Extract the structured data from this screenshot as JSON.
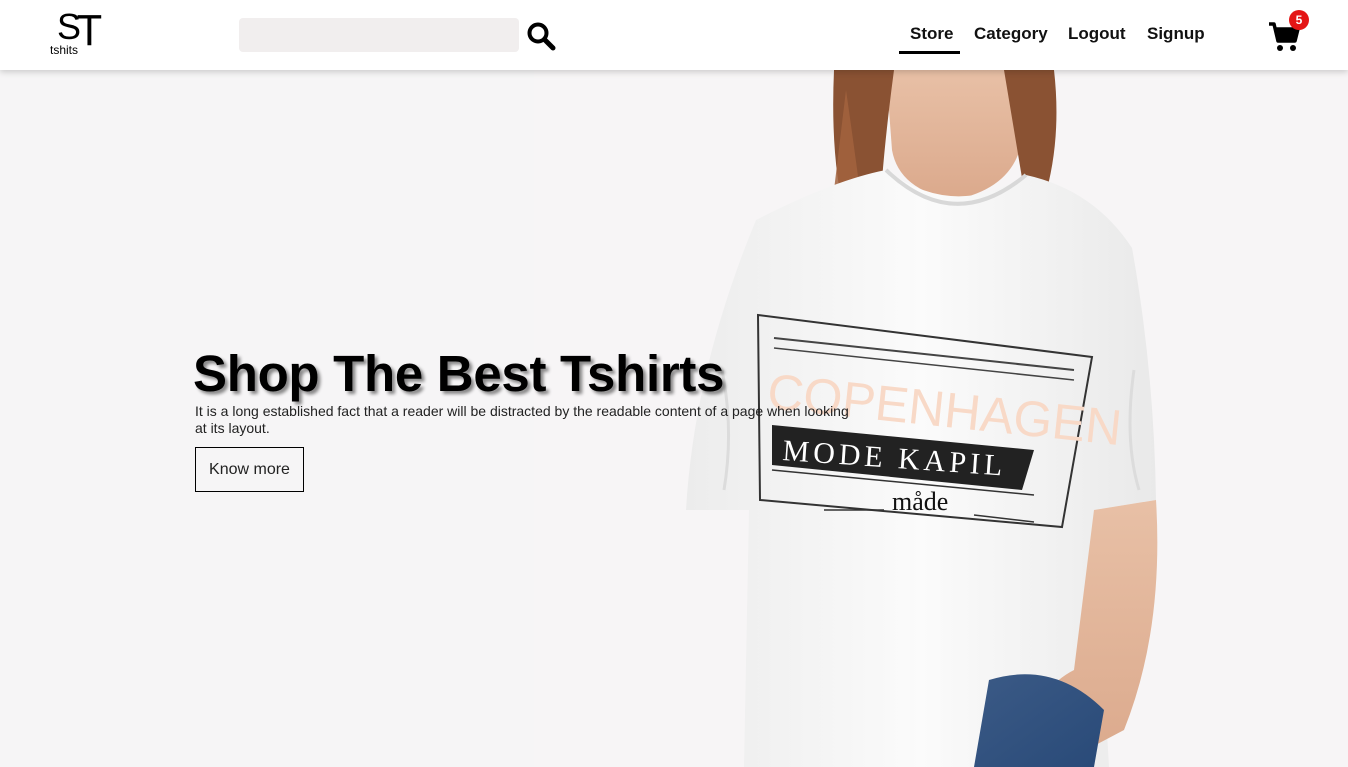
{
  "brand": {
    "logo_s": "S",
    "logo_t": "T",
    "logo_sub": "tshits"
  },
  "search": {
    "placeholder": "",
    "value": "",
    "icon": "search-icon"
  },
  "nav": {
    "items": [
      {
        "label": "Store",
        "active": true
      },
      {
        "label": "Category",
        "active": false
      },
      {
        "label": "Logout",
        "active": false
      },
      {
        "label": "Signup",
        "active": false
      }
    ]
  },
  "cart": {
    "icon": "shopping-cart-icon",
    "count": "5"
  },
  "hero": {
    "title": "Shop The Best Tshirts",
    "text": "It is a long established fact that a reader will be distracted by the readable content of a page when looking at its layout.",
    "button_label": "Know more",
    "shirt_print": {
      "line1": "COPENHAGEN",
      "line2": "MODE KAPIL",
      "line3": "måde"
    }
  },
  "colors": {
    "badge": "#e41515",
    "search_bg": "#f1eeee",
    "hero_bg": "#f6f5f6",
    "accent": "#000000"
  }
}
